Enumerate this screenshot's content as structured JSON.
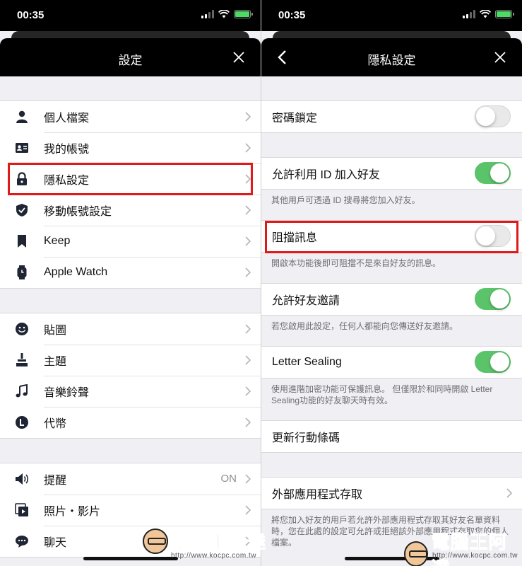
{
  "status_bar": {
    "time": "00:35"
  },
  "left": {
    "title": "設定",
    "groups": [
      [
        {
          "label": "個人檔案",
          "icon": "person-icon"
        },
        {
          "label": "我的帳號",
          "icon": "id-card-icon"
        },
        {
          "label": "隱私設定",
          "icon": "lock-icon"
        },
        {
          "label": "移動帳號設定",
          "icon": "shield-icon"
        },
        {
          "label": "Keep",
          "icon": "bookmark-icon"
        },
        {
          "label": "Apple Watch",
          "icon": "watch-icon"
        }
      ],
      [
        {
          "label": "貼圖",
          "icon": "smiley-icon"
        },
        {
          "label": "主題",
          "icon": "brush-icon"
        },
        {
          "label": "音樂鈴聲",
          "icon": "music-note-icon"
        },
        {
          "label": "代幣",
          "icon": "coin-icon"
        }
      ],
      [
        {
          "label": "提醒",
          "icon": "speaker-icon",
          "value": "ON"
        },
        {
          "label": "照片・影片",
          "icon": "photo-video-icon"
        },
        {
          "label": "聊天",
          "icon": "chat-icon"
        }
      ]
    ]
  },
  "right": {
    "title": "隱私設定",
    "passcode_lock": {
      "label": "密碼鎖定",
      "on": false
    },
    "allow_id": {
      "label": "允許利用 ID 加入好友",
      "on": true,
      "note": "其他用戶可透過 ID 搜尋將您加入好友。"
    },
    "block_messages": {
      "label": "阻擋訊息",
      "on": false,
      "note": "開啟本功能後即可阻擋不是來自好友的訊息。"
    },
    "allow_invites": {
      "label": "允許好友邀請",
      "on": true,
      "note": "若您啟用此設定，任何人都能向您傳送好友邀請。"
    },
    "letter_sealing": {
      "label": "Letter Sealing",
      "on": true,
      "note": "使用進階加密功能可保護訊息。 但僅限於和同時開啟 Letter Sealing功能的好友聊天時有效。"
    },
    "update_qr": {
      "label": "更新行動條碼"
    },
    "external_access": {
      "label": "外部應用程式存取",
      "note": "將您加入好友的用戶若允許外部應用程式存取其好友名單資料時，您在此處的設定可允許或拒絕該外部應用程式存取您的個人檔案。"
    }
  },
  "watermark": {
    "text": "電腦王阿達",
    "url": "http://www.kocpc.com.tw"
  },
  "colors": {
    "toggle_on": "#5bc36a",
    "highlight": "#e01919"
  }
}
